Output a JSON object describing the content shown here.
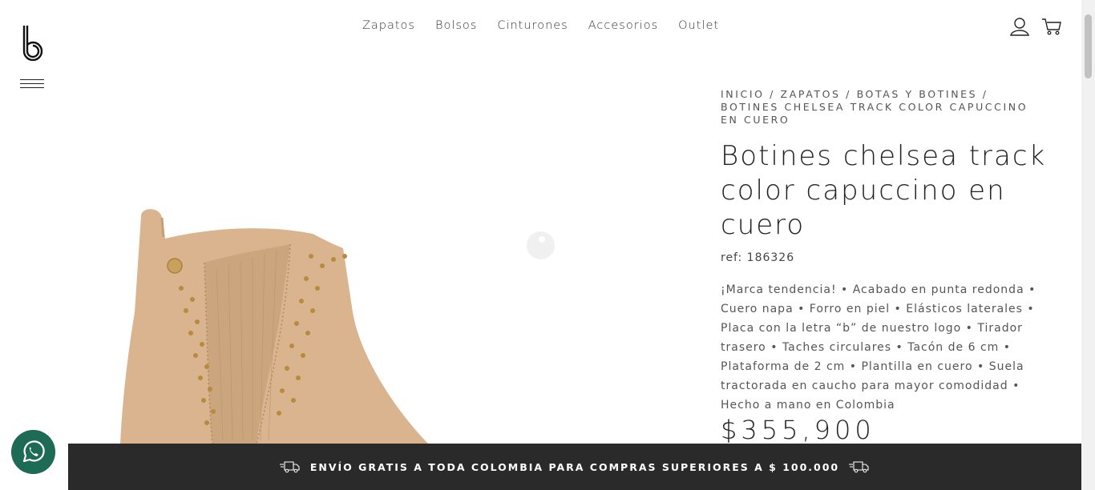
{
  "nav": {
    "items": [
      {
        "label": "Zapatos"
      },
      {
        "label": "Bolsos"
      },
      {
        "label": "Cinturones"
      },
      {
        "label": "Accesorios"
      },
      {
        "label": "Outlet"
      }
    ]
  },
  "header": {
    "logo_icon": "brand-logo-b",
    "user_icon": "user-icon",
    "cart_icon": "cart-icon"
  },
  "breadcrumb": {
    "items": [
      "INICIO",
      "ZAPATOS",
      "BOTAS Y BOTINES",
      "BOTINES CHELSEA TRACK COLOR CAPUCCINO EN CUERO"
    ],
    "separator": " / "
  },
  "product": {
    "title": "Botines chelsea track color capuccino en cuero",
    "ref": "ref: 186326",
    "description": "¡Marca tendencia! • Acabado en punta redonda • Cuero napa • Forro en piel • Elásticos laterales • Placa con la letra “b” de nuestro logo • Tirador trasero • Taches circulares • Tacón de 6 cm • Plataforma de 2 cm • Plantilla en cuero • Suela tractorada en caucho para mayor comodidad • Hecho a mano en Colombia",
    "price": "$355,900"
  },
  "shipping_banner": {
    "text": "ENVÍO GRATIS A TODA COLOMBIA PARA COMPRAS SUPERIORES A $ 100.000"
  },
  "colors": {
    "banner_bg": "#2a2a2a",
    "whatsapp": "#1d6b55",
    "boot": "#d9b48e"
  }
}
